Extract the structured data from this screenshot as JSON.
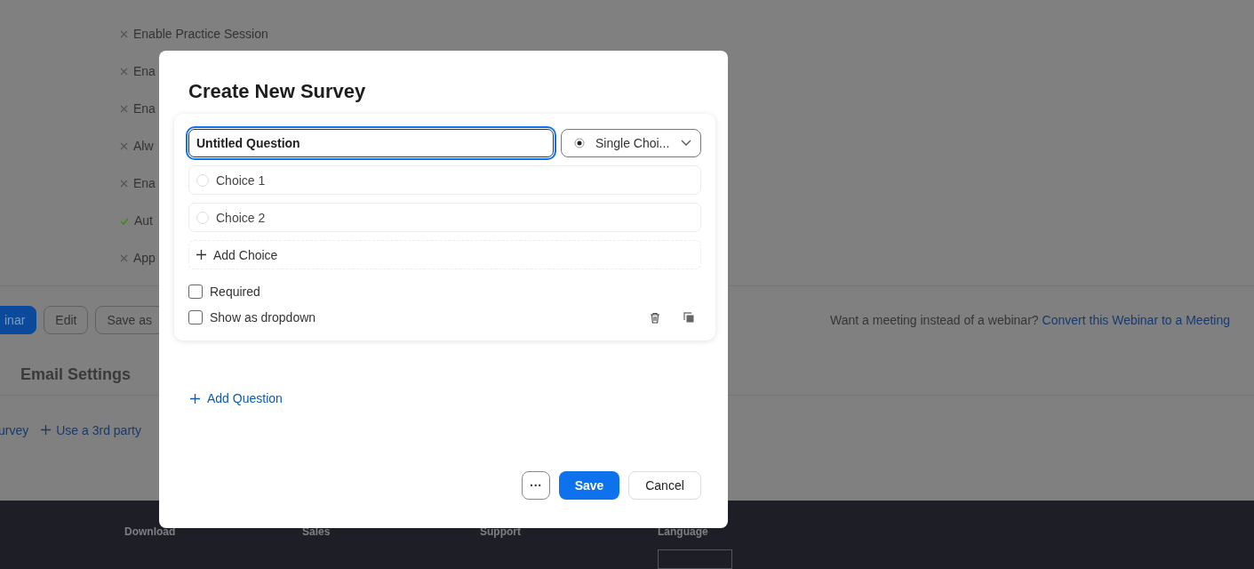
{
  "background_page": {
    "settings": [
      {
        "label": "Enable Practice Session",
        "kind": "cross"
      },
      {
        "label": "Ena",
        "kind": "cross"
      },
      {
        "label": "Ena",
        "kind": "cross"
      },
      {
        "label": "Alw",
        "kind": "cross"
      },
      {
        "label": "Ena",
        "kind": "cross"
      },
      {
        "label": "Aut",
        "kind": "check"
      },
      {
        "label": "App",
        "kind": "cross"
      }
    ],
    "actions": [
      {
        "label": "inar",
        "kind": "primary"
      },
      {
        "label": "Edit",
        "kind": "outline"
      },
      {
        "label": "Save as",
        "kind": "outline"
      }
    ],
    "convert_prompt": "Want a meeting instead of a webinar?",
    "convert_link": "Convert this Webinar to a Meeting",
    "section_title": "Email Settings",
    "links": [
      {
        "label": "urvey",
        "icon": false
      },
      {
        "label": "Use a 3rd party",
        "icon": true
      }
    ],
    "footer": {
      "columns": [
        "Download",
        "Sales",
        "Support",
        "Language"
      ]
    }
  },
  "dialog": {
    "title": "Create New Survey",
    "question": {
      "value": "Untitled Question",
      "type": "Single Choi...",
      "choices": [
        {
          "label": "Choice 1",
          "selected": false
        },
        {
          "label": "Choice 2",
          "selected": false
        }
      ],
      "add_choice": "Add Choice",
      "options": [
        {
          "label": "Required",
          "checked": false
        },
        {
          "label": "Show as dropdown",
          "checked": false
        }
      ]
    },
    "add_question": "Add Question",
    "buttons": {
      "more": "···",
      "save": "Save",
      "cancel": "Cancel"
    }
  }
}
